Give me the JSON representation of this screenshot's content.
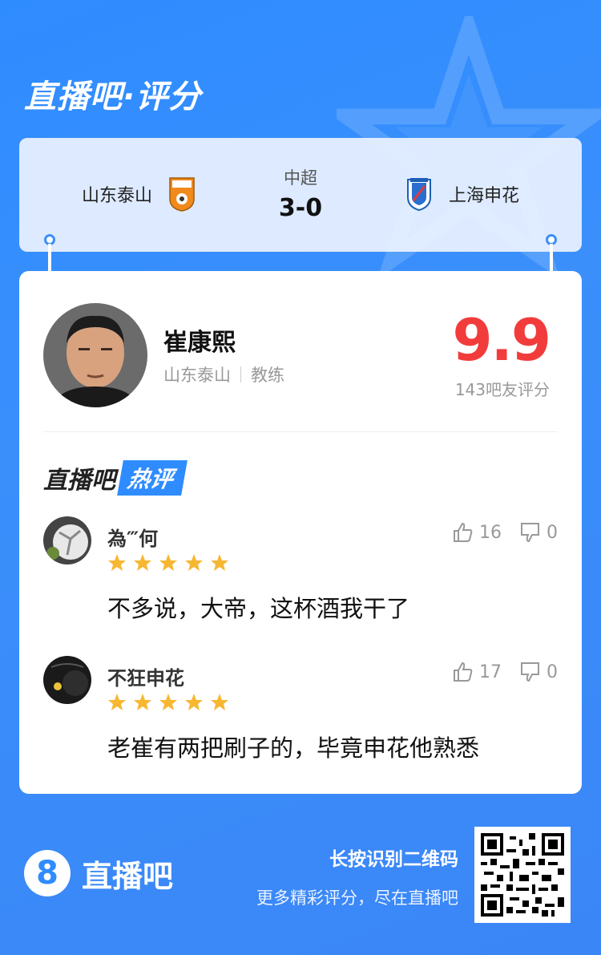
{
  "brand": {
    "title": "直播吧·评分"
  },
  "match": {
    "home_team": "山东泰山",
    "away_team": "上海申花",
    "league": "中超",
    "score": "3-0"
  },
  "player": {
    "name": "崔康熙",
    "team": "山东泰山",
    "role": "教练",
    "rating": "9.9",
    "rating_count": "143吧友评分"
  },
  "hot": {
    "title": "直播吧",
    "badge": "热评"
  },
  "comments": [
    {
      "user": "為‴何",
      "stars": 5,
      "text": "不多说，大帝，这杯酒我干了",
      "likes": "16",
      "dislikes": "0"
    },
    {
      "user": "不狂申花",
      "stars": 5,
      "text": "老崔有两把刷子的，毕竟申花他熟悉",
      "likes": "17",
      "dislikes": "0"
    }
  ],
  "footer": {
    "logo_digit": "8",
    "logo_text": "直播吧",
    "qr_title": "长按识别二维码",
    "qr_subtitle": "更多精彩评分，尽在直播吧"
  },
  "colors": {
    "accent": "#2f8cff",
    "rating": "#f23c3c",
    "star": "#f7b731"
  },
  "icons": [
    "thumb-up-icon",
    "thumb-down-icon",
    "star-icon",
    "qr-code-icon"
  ]
}
